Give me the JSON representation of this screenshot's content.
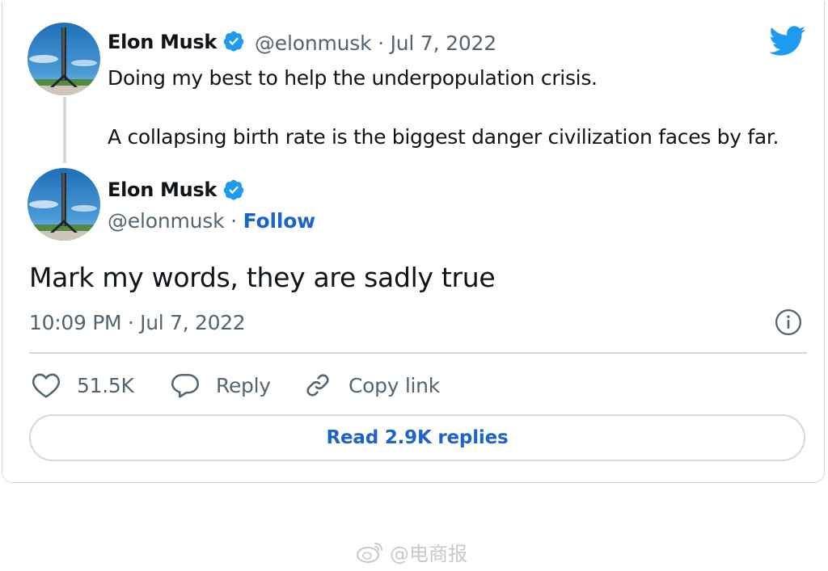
{
  "reply_tweet": {
    "author_name": "Elon Musk",
    "handle_date": "@elonmusk · Jul 7, 2022",
    "text_line_1": "Doing my best to help the underpopulation crisis.",
    "text_line_2": "A collapsing birth rate is the biggest danger civilization faces by far."
  },
  "main_tweet": {
    "author_name": "Elon Musk",
    "handle": "@elonmusk · ",
    "follow_label": "Follow",
    "text": "Mark my words, they are sadly true",
    "timestamp": "10:09 PM · Jul 7, 2022"
  },
  "actions": {
    "like_count": "51.5K",
    "reply_label": "Reply",
    "copy_link_label": "Copy link"
  },
  "read_replies_label": "Read 2.9K replies",
  "watermark": {
    "text": "@电商报"
  },
  "icons": {
    "verified": "verified-badge-icon",
    "twitter": "twitter-bird-icon",
    "info": "info-icon",
    "like": "heart-icon",
    "reply": "speech-bubble-icon",
    "copy_link": "link-icon",
    "weibo": "weibo-icon"
  },
  "colors": {
    "accent_blue": "#1d64c8",
    "verified_blue": "#1d9bf0",
    "twitter_blue": "#1d9bf0",
    "secondary_text": "#536471",
    "border": "#cfd9de"
  }
}
